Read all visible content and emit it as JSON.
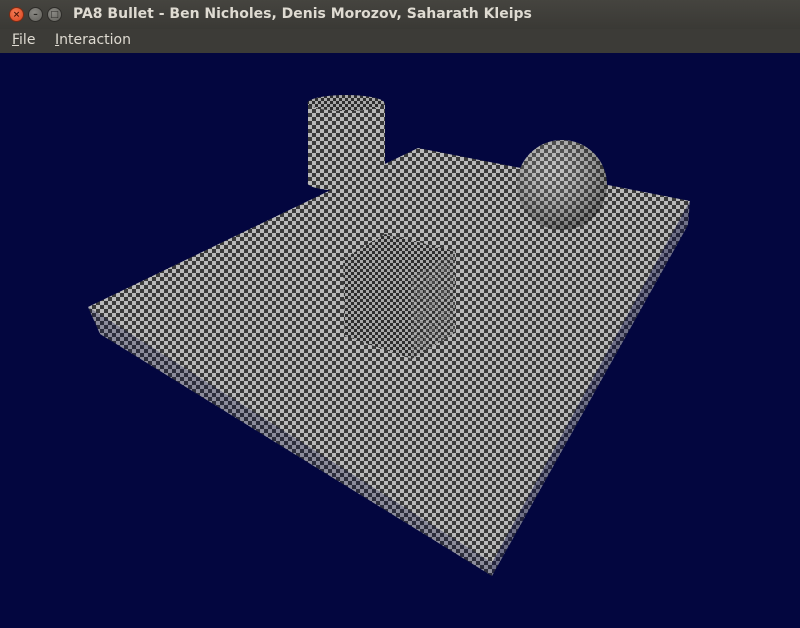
{
  "window": {
    "title": "PA8 Bullet - Ben Nicholes, Denis Morozov, Saharath Kleips",
    "controls": {
      "close_glyph": "×",
      "minimize_glyph": "–",
      "maximize_glyph": "□"
    }
  },
  "menu": {
    "items": [
      {
        "mnemonic": "F",
        "rest": "ile"
      },
      {
        "mnemonic": "I",
        "rest": "nteraction"
      }
    ]
  },
  "scene": {
    "background_color": "#03063f",
    "texture_light": "#b9b9b9",
    "texture_dark": "#3a3a3a",
    "objects": [
      "checkered-table",
      "cylinder",
      "sphere",
      "cube"
    ]
  }
}
